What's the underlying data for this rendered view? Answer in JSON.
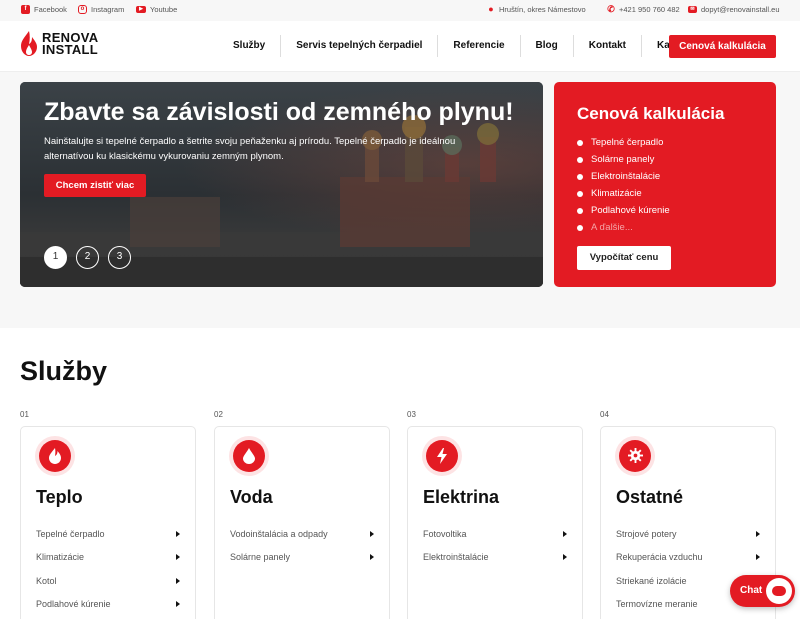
{
  "topbar": {
    "social": [
      {
        "label": "Facebook",
        "icon": "facebook-icon"
      },
      {
        "label": "Instagram",
        "icon": "instagram-icon"
      },
      {
        "label": "Youtube",
        "icon": "youtube-icon"
      }
    ],
    "location": "Hruštín, okres Námestovo",
    "phone": "+421 950 760 482",
    "email": "dopyt@renovainstall.eu"
  },
  "header": {
    "logo_line1": "RENOVA",
    "logo_line2": "INSTALL",
    "nav": [
      "Služby",
      "Servis tepelných čerpadiel",
      "Referencie",
      "Blog",
      "Kontakt",
      "Kariéra"
    ],
    "cta": "Cenová kalkulácia"
  },
  "hero": {
    "title": "Zbavte sa závislosti od zemného plynu!",
    "text": "Nainštalujte si tepelné čerpadlo a šetrite svoju peňaženku aj prírodu. Tepelné čerpadlo je ideálnou alternatívou ku klasickému vykurovaniu zemným plynom.",
    "button": "Chcem zistiť viac",
    "slides": [
      "1",
      "2",
      "3"
    ],
    "active_slide": 1
  },
  "calculator": {
    "title": "Cenová kalkulácia",
    "items": [
      "Tepelné čerpadlo",
      "Solárne panely",
      "Elektroinštalácie",
      "Klimatizácie",
      "Podlahové kúrenie"
    ],
    "more": "A ďalšie...",
    "button": "Vypočítať cenu"
  },
  "services": {
    "title": "Služby",
    "cards": [
      {
        "num": "01",
        "title": "Teplo",
        "icon": "flame-icon",
        "items": [
          "Tepelné čerpadlo",
          "Klimatizácie",
          "Kotol",
          "Podlahové kúrenie"
        ]
      },
      {
        "num": "02",
        "title": "Voda",
        "icon": "water-drop-icon",
        "items": [
          "Vodoinštalácia a odpady",
          "Solárne panely"
        ]
      },
      {
        "num": "03",
        "title": "Elektrina",
        "icon": "lightning-icon",
        "items": [
          "Fotovoltika",
          "Elektroinštalácie"
        ]
      },
      {
        "num": "04",
        "title": "Ostatné",
        "icon": "gear-icon",
        "items": [
          "Strojové potery",
          "Rekuperácia vzduchu",
          "Striekané izolácie",
          "Termovízne meranie"
        ]
      }
    ]
  },
  "chat": {
    "label": "Chat"
  },
  "colors": {
    "accent": "#e31b23"
  }
}
